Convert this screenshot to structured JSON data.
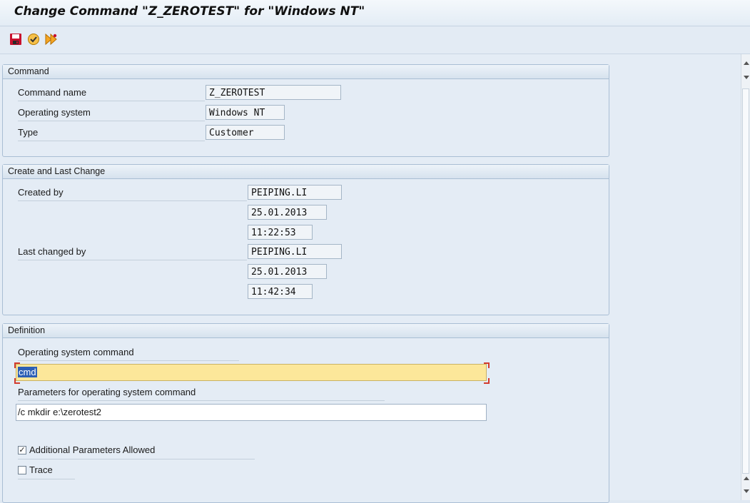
{
  "window": {
    "title": "Change Command \"Z_ZEROTEST\" for \"Windows NT\""
  },
  "toolbar": {
    "buttons": [
      {
        "icon": "save-icon",
        "color": "#c8102e"
      },
      {
        "icon": "check-icon",
        "color": "#d48a00"
      },
      {
        "icon": "execute-icon",
        "color": "#d48a00"
      }
    ]
  },
  "command_group": {
    "title": "Command",
    "command_name_label": "Command name",
    "command_name_value": "Z_ZEROTEST",
    "os_label": "Operating system",
    "os_value": "Windows NT",
    "type_label": "Type",
    "type_value": "Customer"
  },
  "change_group": {
    "title": "Create and Last Change",
    "created_by_label": "Created by",
    "created_by_value": "PEIPING.LI",
    "created_date": "25.01.2013",
    "created_time": "11:22:53",
    "changed_by_label": "Last changed by",
    "changed_by_value": "PEIPING.LI",
    "changed_date": "25.01.2013",
    "changed_time": "11:42:34"
  },
  "definition_group": {
    "title": "Definition",
    "os_command_label": "Operating system command",
    "os_command_value": "cmd",
    "params_label": "Parameters for operating system command",
    "params_value": "/c mkdir e:\\zerotest2",
    "additional_params_label": "Additional Parameters Allowed",
    "additional_params_checked": true,
    "trace_label": "Trace",
    "trace_checked": false
  },
  "colors": {
    "focus_field": "#fce79a",
    "selection": "#2c5fb5",
    "group_border": "#a9bed4"
  }
}
